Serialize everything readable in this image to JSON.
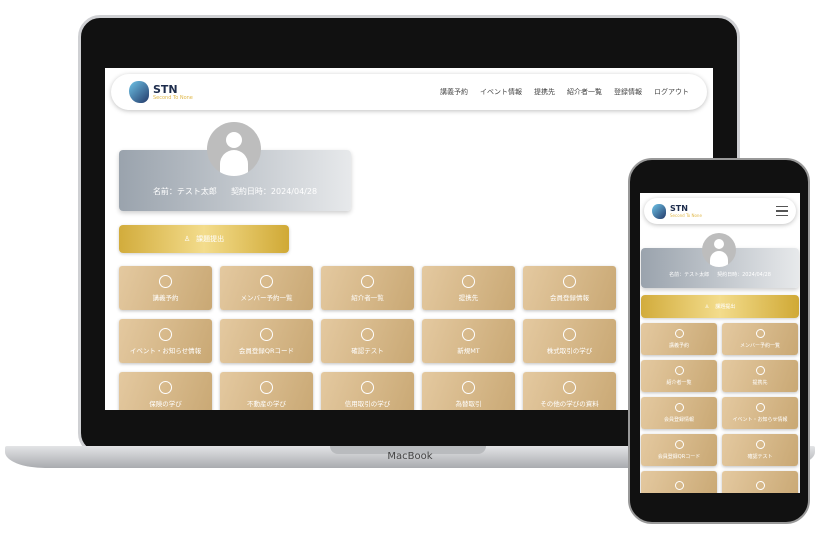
{
  "device_label": "MacBook",
  "brand": {
    "name": "STN",
    "tagline": "Second To None"
  },
  "nav": [
    "講義予約",
    "イベント情報",
    "提携先",
    "紹介者一覧",
    "登録情報",
    "ログアウト"
  ],
  "profile": {
    "name": "名前：テスト太郎",
    "contract": "契約日時：2024/04/28"
  },
  "submit_label": "課題提出",
  "tiles": [
    {
      "label": "講義予約",
      "icon": "clock-check-icon"
    },
    {
      "label": "メンバー予約一覧",
      "icon": "clock-check-icon"
    },
    {
      "label": "紹介者一覧",
      "icon": "users-icon"
    },
    {
      "label": "提携先",
      "icon": "globe-icon"
    },
    {
      "label": "会員登録情報",
      "icon": "user-circle-icon"
    },
    {
      "label": "イベント・お知らせ情報",
      "icon": "chat-icon"
    },
    {
      "label": "会員登録QRコード",
      "icon": "user-circle-icon"
    },
    {
      "label": "確認テスト",
      "icon": "document-icon"
    },
    {
      "label": "新規MT",
      "icon": "document-icon"
    },
    {
      "label": "株式取引の学び",
      "icon": "chart-icon"
    },
    {
      "label": "保険の学び",
      "icon": "house-icon"
    },
    {
      "label": "不動産の学び",
      "icon": "building-icon"
    },
    {
      "label": "信用取引の学び",
      "icon": "piggy-bank-icon"
    },
    {
      "label": "為替取引",
      "icon": "handshake-icon"
    },
    {
      "label": "その他の学びの資料",
      "icon": "document-icon"
    }
  ],
  "phone_tiles": [
    {
      "label": "講義予約"
    },
    {
      "label": "メンバー予約一覧"
    },
    {
      "label": "紹介者一覧"
    },
    {
      "label": "提携先"
    },
    {
      "label": "会員登録情報"
    },
    {
      "label": "イベント・お知らせ情報"
    },
    {
      "label": "会員登録QRコード"
    },
    {
      "label": "確認テスト"
    },
    {
      "label": ""
    },
    {
      "label": ""
    }
  ]
}
